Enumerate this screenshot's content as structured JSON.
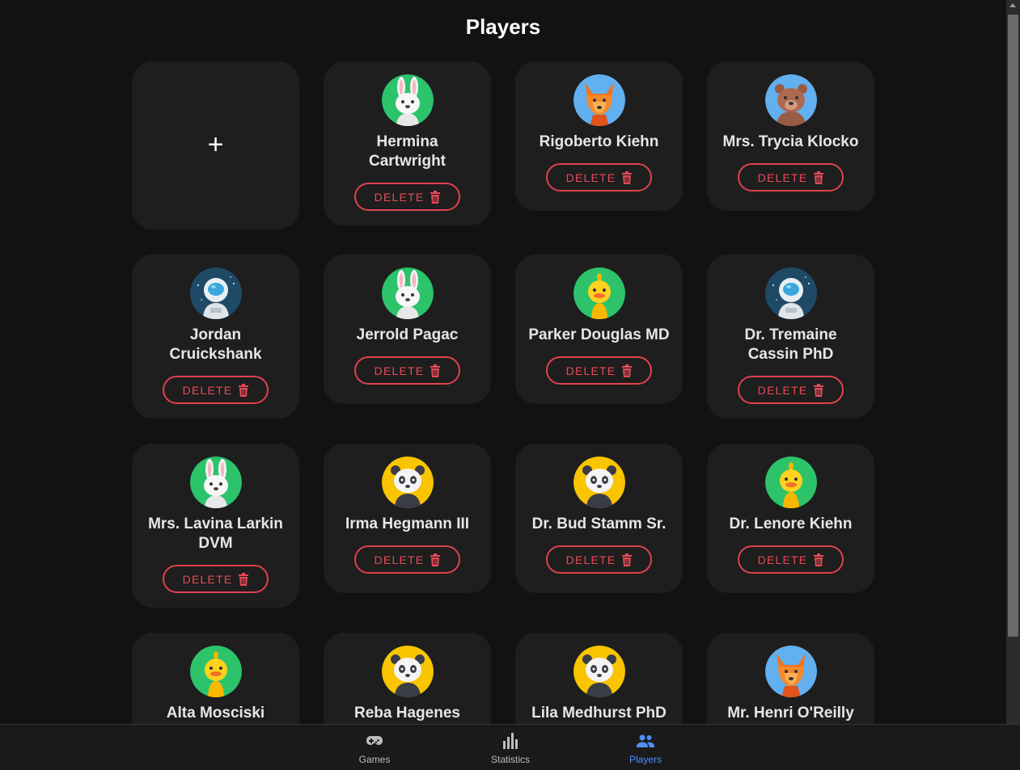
{
  "page": {
    "title": "Players",
    "add_label": "+"
  },
  "delete_label": "DELETE",
  "players": [
    {
      "name": "Hermina Cartwright",
      "avatar": "rabbit"
    },
    {
      "name": "Rigoberto Kiehn",
      "avatar": "fox"
    },
    {
      "name": "Mrs. Trycia Klocko",
      "avatar": "bear"
    },
    {
      "name": "Jordan Cruickshank",
      "avatar": "astronaut"
    },
    {
      "name": "Jerrold Pagac",
      "avatar": "rabbit"
    },
    {
      "name": "Parker Douglas MD",
      "avatar": "duck"
    },
    {
      "name": "Dr. Tremaine Cassin PhD",
      "avatar": "astronaut"
    },
    {
      "name": "Mrs. Lavina Larkin DVM",
      "avatar": "rabbit"
    },
    {
      "name": "Irma Hegmann III",
      "avatar": "panda"
    },
    {
      "name": "Dr. Bud Stamm Sr.",
      "avatar": "panda"
    },
    {
      "name": "Dr. Lenore Kiehn",
      "avatar": "duck"
    },
    {
      "name": "Alta Mosciski",
      "avatar": "duck"
    },
    {
      "name": "Reba Hagenes",
      "avatar": "panda"
    },
    {
      "name": "Lila Medhurst PhD",
      "avatar": "panda"
    },
    {
      "name": "Mr. Henri O'Reilly",
      "avatar": "fox"
    }
  ],
  "bottom_nav": {
    "items": [
      {
        "label": "Games",
        "icon": "gamepad-icon",
        "active": false
      },
      {
        "label": "Statistics",
        "icon": "bar-chart-icon",
        "active": false
      },
      {
        "label": "Players",
        "icon": "people-icon",
        "active": true
      }
    ]
  },
  "colors": {
    "background": "#121212",
    "card": "#1e1e1e",
    "danger": "#e84a57",
    "active_nav": "#4f8ff7"
  }
}
